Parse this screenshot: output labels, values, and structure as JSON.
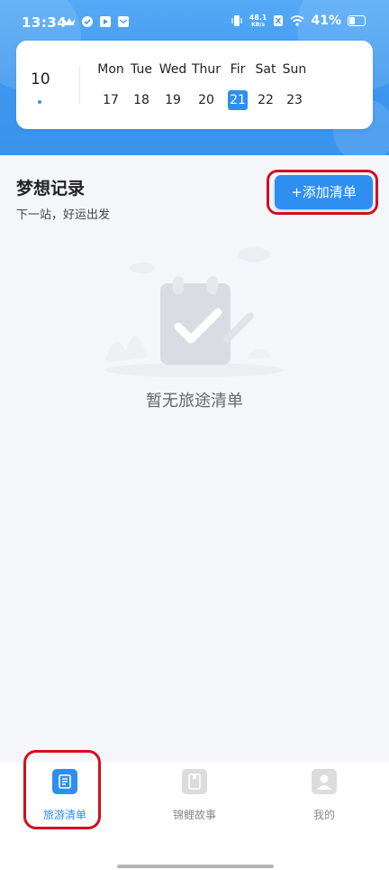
{
  "status_bar": {
    "time": "13:34",
    "net_speed_value": "48.1",
    "net_speed_unit": "KB/s",
    "battery_percent": "41%",
    "battery_level": 0.41
  },
  "calendar": {
    "month": "10",
    "week": [
      {
        "name": "Mon",
        "day": "17"
      },
      {
        "name": "Tue",
        "day": "18"
      },
      {
        "name": "Wed",
        "day": "19"
      },
      {
        "name": "Thur",
        "day": "20"
      },
      {
        "name": "Fir",
        "day": "21"
      },
      {
        "name": "Sat",
        "day": "22"
      },
      {
        "name": "Sun",
        "day": "23"
      }
    ],
    "selected_index": 4
  },
  "header": {
    "title": "梦想记录",
    "subtitle": "下一站，好运出发",
    "add_button_label": "+添加清单"
  },
  "empty_state": {
    "text": "暂无旅途清单"
  },
  "tabbar": {
    "tabs": [
      {
        "label": "旅游清单",
        "icon": "list-icon",
        "active": true
      },
      {
        "label": "锦鲤故事",
        "icon": "book-icon",
        "active": false
      },
      {
        "label": "我的",
        "icon": "user-icon",
        "active": false
      }
    ]
  },
  "colors": {
    "primary": "#2f8ff0",
    "annotation": "#d0101e",
    "header_gradient_top": "#55a9f6"
  }
}
